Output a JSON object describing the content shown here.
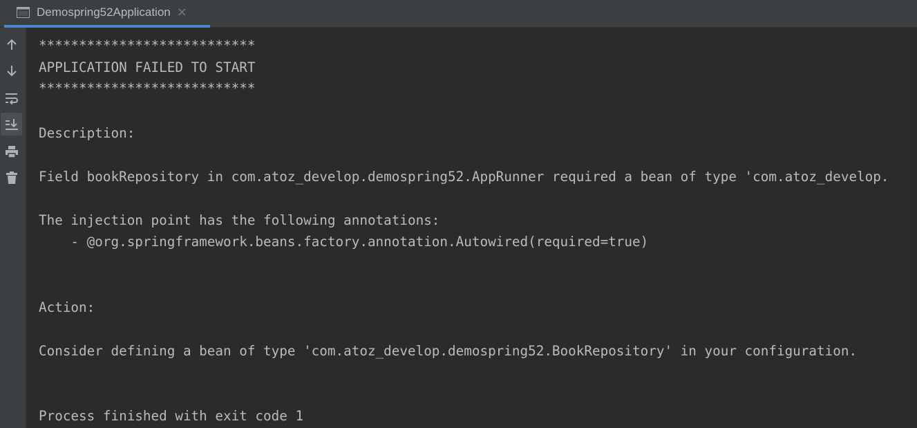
{
  "tab": {
    "title": "Demospring52Application",
    "close_glyph": "×",
    "icon": "console-window-icon"
  },
  "toolbar": {
    "items": [
      {
        "name": "scroll-up-icon"
      },
      {
        "name": "scroll-down-icon"
      },
      {
        "name": "soft-wrap-icon"
      },
      {
        "name": "scroll-to-end-icon",
        "active": true
      },
      {
        "name": "print-icon"
      },
      {
        "name": "clear-all-icon"
      }
    ]
  },
  "console": {
    "lines": [
      "***************************",
      "APPLICATION FAILED TO START",
      "***************************",
      "Description:",
      "Field bookRepository in com.atoz_develop.demospring52.AppRunner required a bean of type 'com.atoz_develop.",
      "The injection point has the following annotations:",
      "    - @org.springframework.beans.factory.annotation.Autowired(required=true)",
      "Action:",
      "Consider defining a bean of type 'com.atoz_develop.demospring52.BookRepository' in your configuration.",
      "Process finished with exit code 1"
    ]
  },
  "colors": {
    "background": "#2b2b2b",
    "toolbar": "#3c3f41",
    "text": "#bbbbbb",
    "tab_underline": "#4a88c7",
    "icon": "#afb1b3"
  }
}
